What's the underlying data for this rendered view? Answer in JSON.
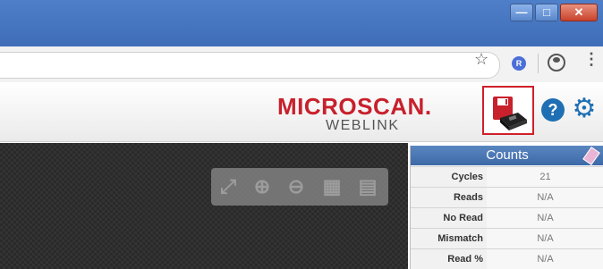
{
  "window": {
    "buttons": {
      "minimize": "—",
      "maximize": "□",
      "close": "✕"
    }
  },
  "browser": {
    "bookmark_icon": "☆",
    "extension_letter": "R",
    "menu_icon": "⋮"
  },
  "header": {
    "logo_main": "MICROSCAN.",
    "logo_sub": "WEBLINK",
    "help_icon": "?",
    "settings_icon": "⚙",
    "save_icon_name": "floppy-disk-icon"
  },
  "viewer_toolbar": {
    "fit_icon": "⤢",
    "zoom_in_icon": "⊕",
    "zoom_out_icon": "⊖",
    "grid_icon": "▦",
    "save_icon": "▤"
  },
  "counts": {
    "title": "Counts",
    "rows": [
      {
        "label": "Cycles",
        "value": "21"
      },
      {
        "label": "Reads",
        "value": "N/A"
      },
      {
        "label": "No Read",
        "value": "N/A"
      },
      {
        "label": "Mismatch",
        "value": "N/A"
      },
      {
        "label": "Read %",
        "value": "N/A"
      }
    ]
  },
  "colors": {
    "brand_red": "#c8202c",
    "accent_blue": "#1e6fb3",
    "counts_header": "#4a77b4"
  }
}
